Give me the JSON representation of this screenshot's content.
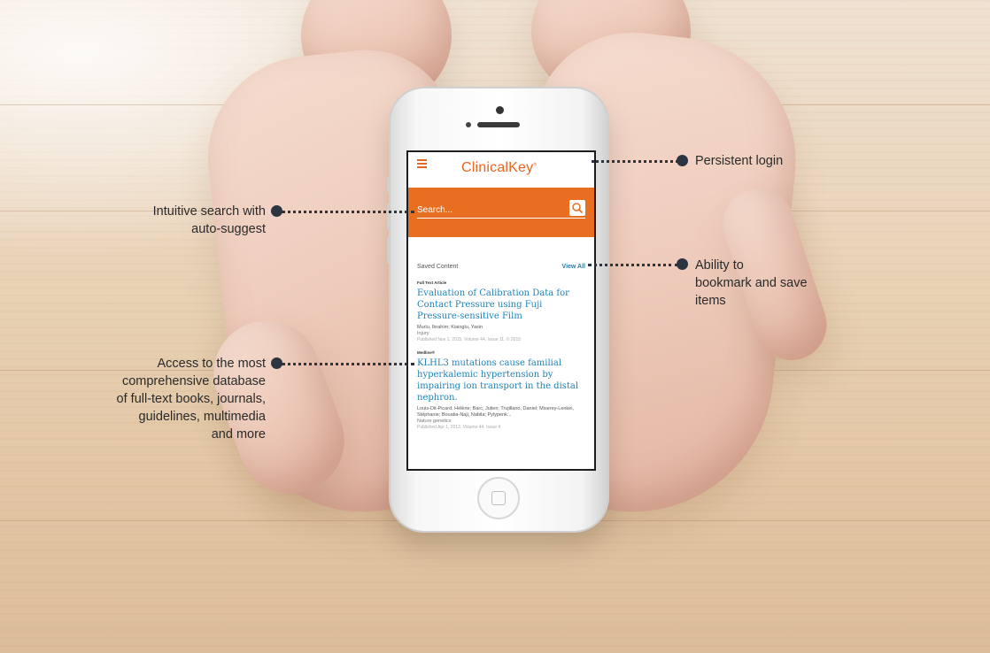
{
  "app": {
    "brand": "ClinicalKey",
    "brand_mark": "®",
    "search_placeholder": "Search...",
    "saved_content_label": "Saved Content",
    "view_all_label": "View All"
  },
  "articles": [
    {
      "type": "Full Text Article",
      "title": "Evaluation of Calibration Data for Contact Pressure using Fuji Pressure-sensitive Film",
      "authors": "Murlu, Ibrahim; Kiaioglu, Yasin",
      "journal": "Injury",
      "published": "Published Nov 1, 2015. Volume 44, Issue 11. © 2015"
    },
    {
      "type": "Medline®",
      "title": "KLHL3 mutations cause familial hyperkalemic hypertension by impairing ion transport in the distal nephron.",
      "authors": "Louis-Dit-Picard, Hélène; Barc, Julien; Trujillano, Daniel; Miserey-Lenkei, Stéphanie; Bouatia-Naji, Nabila; Pylypenk...",
      "journal": "Nature genetics",
      "published": "Published Apr 1, 2012. Volume 44. Issue 4"
    }
  ],
  "callouts": {
    "persistent_login": "Persistent login",
    "search": [
      "Intuitive search with",
      "auto-suggest"
    ],
    "bookmark": [
      "Ability to",
      "bookmark and save",
      "items"
    ],
    "access": [
      "Access to the most",
      "comprehensive database",
      "of full-text books, journals,",
      "guidelines, multimedia",
      "and more"
    ]
  },
  "colors": {
    "accent": "#e86f22",
    "link": "#1e83b8",
    "callout_dot": "#2c3440"
  },
  "icons": {
    "menu": "hamburger-icon",
    "search": "search-icon"
  }
}
